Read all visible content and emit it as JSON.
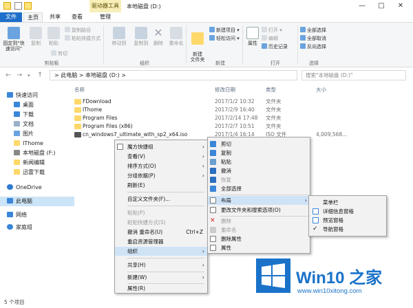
{
  "window": {
    "title": "本地磁盘 (D:)",
    "contextual_tab": "驱动器工具",
    "minimize": "—",
    "maximize": "□",
    "close": "✕"
  },
  "tabs": [
    "文件",
    "主页",
    "共享",
    "查看",
    "管理"
  ],
  "ribbon": {
    "clipboard": {
      "pin_label": "固定到\"快速访问\"",
      "copy_label": "复制",
      "paste_label": "粘贴",
      "copy_path": "复制路径",
      "paste_shortcut": "粘贴快捷方式",
      "cut": "剪切",
      "group_label": "剪贴板"
    },
    "organize": {
      "move_to": "移动到",
      "copy_to": "复制到",
      "delete": "删除",
      "rename": "重命名",
      "group_label": "组织"
    },
    "new": {
      "new_folder": "新建\n文件夹",
      "new_item": "新建项目 ▾",
      "easy_access": "轻松访问 ▾",
      "group_label": "新建"
    },
    "open": {
      "properties": "属性",
      "open": "打开 ▾",
      "edit": "编辑",
      "history": "历史记录",
      "group_label": "打开"
    },
    "select": {
      "select_all": "全部选择",
      "select_none": "全部取消",
      "invert": "反向选择",
      "group_label": "选择"
    }
  },
  "address": {
    "path": ">  此电脑  >  本地磁盘 (D:)  >",
    "search_placeholder": "搜索\"本地磁盘 (D:)\""
  },
  "nav": {
    "quick_access": "快速访问",
    "items": [
      "桌面",
      "下载",
      "文档",
      "图片",
      "IThome",
      "本地磁盘 (F:)",
      "新闻编辑",
      "迅雷下载"
    ],
    "onedrive": "OneDrive",
    "this_pc": "此电脑",
    "network": "网络",
    "homegroup": "家庭组"
  },
  "columns": {
    "name": "名称",
    "date": "修改日期",
    "type": "类型",
    "size": "大小"
  },
  "files": [
    {
      "name": "FDownload",
      "date": "2017/1/2 10:32",
      "type": "文件夹",
      "size": ""
    },
    {
      "name": "IThome",
      "date": "2017/2/9 16:40",
      "type": "文件夹",
      "size": ""
    },
    {
      "name": "Program Files",
      "date": "2017/2/14 17:48",
      "type": "文件夹",
      "size": ""
    },
    {
      "name": "Program Files (x86)",
      "date": "2017/2/7 10:51",
      "type": "文件夹",
      "size": ""
    },
    {
      "name": "cn_windows7_ultimate_with_sp2_x64.iso",
      "date": "2017/1/4 16:14",
      "type": "ISO 文件",
      "size": "4,009,568..."
    }
  ],
  "status": "5 个项目",
  "menu_main": {
    "items": [
      "魔方快捷组",
      "查看(V)",
      "排序方式(O)",
      "分组依据(P)",
      "刷新(E)",
      "自定义文件夹(F)...",
      "粘贴(P)",
      "粘贴快捷方式(S)",
      "撤消 重命名(U)",
      "重启资源管理器",
      "组织",
      "共享(H)",
      "新建(W)",
      "属性(R)"
    ],
    "shortcut": "Ctrl+Z"
  },
  "menu_sub": {
    "items": [
      "剪切",
      "复制",
      "粘贴",
      "撤消",
      "恢复",
      "全部选择",
      "布局",
      "更改文件夹和搜索选项(O)",
      "删除",
      "重命名",
      "删除属性",
      "属性"
    ]
  },
  "menu_layout": {
    "items": [
      "菜单栏",
      "详细信息窗格",
      "预览窗格",
      "导航窗格"
    ]
  },
  "logo": {
    "name": "Win10 之家",
    "url": "www.win10xitong.com"
  },
  "colors": {
    "accent": "#1e6fc9",
    "contextual_tab": "#f8efb8",
    "folder": "#ffd86a",
    "highlight": "#cfe3f7"
  }
}
